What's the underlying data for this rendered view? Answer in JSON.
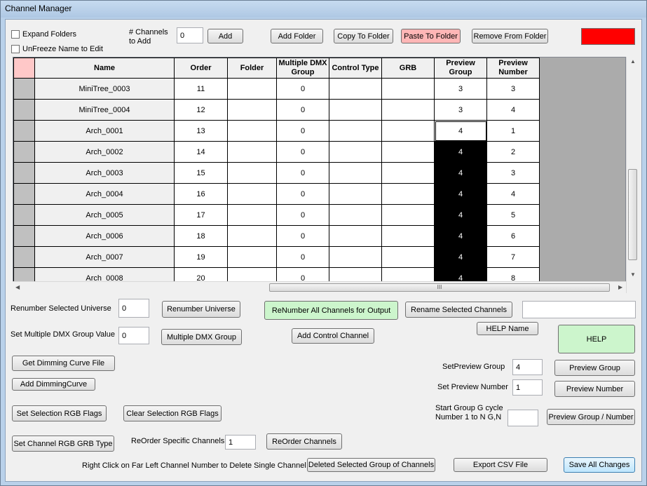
{
  "window": {
    "title": "Channel Manager"
  },
  "top": {
    "expand_folders": "Expand Folders",
    "unfreeze_name": "UnFreeze Name to Edit",
    "channels_to_add_label": "# Channels to Add",
    "channels_to_add_value": "0",
    "add": "Add",
    "add_folder": "Add Folder",
    "copy_to_folder": "Copy To Folder",
    "paste_to_folder": "Paste To Folder",
    "remove_from_folder": "Remove From Folder",
    "color_swatch": "#ff0000"
  },
  "grid": {
    "columns": [
      "Name",
      "Order",
      "Folder",
      "Multiple DMX Group",
      "Control Type",
      "GRB",
      "Preview Group",
      "Preview Number"
    ],
    "rows": [
      {
        "name": "MiniTree_0003",
        "order": "11",
        "folder": "",
        "dmx": "0",
        "control": "",
        "grb": "",
        "pgroup": "3",
        "pnumber": "3"
      },
      {
        "name": "MiniTree_0004",
        "order": "12",
        "folder": "",
        "dmx": "0",
        "control": "",
        "grb": "",
        "pgroup": "3",
        "pnumber": "4"
      },
      {
        "name": "Arch_0001",
        "order": "13",
        "folder": "",
        "dmx": "0",
        "control": "",
        "grb": "",
        "pgroup": "4",
        "pnumber": "1"
      },
      {
        "name": "Arch_0002",
        "order": "14",
        "folder": "",
        "dmx": "0",
        "control": "",
        "grb": "",
        "pgroup": "4",
        "pnumber": "2"
      },
      {
        "name": "Arch_0003",
        "order": "15",
        "folder": "",
        "dmx": "0",
        "control": "",
        "grb": "",
        "pgroup": "4",
        "pnumber": "3"
      },
      {
        "name": "Arch_0004",
        "order": "16",
        "folder": "",
        "dmx": "0",
        "control": "",
        "grb": "",
        "pgroup": "4",
        "pnumber": "4"
      },
      {
        "name": "Arch_0005",
        "order": "17",
        "folder": "",
        "dmx": "0",
        "control": "",
        "grb": "",
        "pgroup": "4",
        "pnumber": "5"
      },
      {
        "name": "Arch_0006",
        "order": "18",
        "folder": "",
        "dmx": "0",
        "control": "",
        "grb": "",
        "pgroup": "4",
        "pnumber": "6"
      },
      {
        "name": "Arch_0007",
        "order": "19",
        "folder": "",
        "dmx": "0",
        "control": "",
        "grb": "",
        "pgroup": "4",
        "pnumber": "7"
      },
      {
        "name": "Arch_0008",
        "order": "20",
        "folder": "",
        "dmx": "0",
        "control": "",
        "grb": "",
        "pgroup": "4",
        "pnumber": "8"
      }
    ],
    "selection": {
      "current_row": 2,
      "selected_rows": [
        3,
        4,
        5,
        6,
        7,
        8,
        9
      ]
    },
    "hscroll_grip": "III"
  },
  "bottom": {
    "renumber_universe_label": "Renumber Selected Universe",
    "renumber_universe_value": "0",
    "renumber_universe": "Renumber Universe",
    "renumber_all": "ReNumber All Channels for Output",
    "rename_selected": "Rename Selected Channels",
    "rename_value": "",
    "help_name": "HELP Name",
    "help": "HELP",
    "set_dmx_label": "Set Multiple DMX Group Value",
    "set_dmx_value": "0",
    "multiple_dmx_group": "Multiple DMX Group",
    "add_control_channel": "Add Control Channel",
    "get_dimming_curve": "Get Dimming Curve File",
    "add_dimming_curve": "Add DimmingCurve",
    "set_preview_group_label": "SetPreview Group",
    "set_preview_group_value": "4",
    "preview_group": "Preview Group",
    "set_preview_number_label": "Set Preview Number",
    "set_preview_number_value": "1",
    "preview_number": "Preview Number",
    "set_selection_rgb": "Set Selection RGB Flags",
    "clear_selection_rgb": "Clear Selection RGB Flags",
    "start_group_label": "Start Group G cycle Number 1 to N G,N",
    "start_group_value": "",
    "preview_group_number": "Preview Group / Number",
    "set_channel_rgb_grb": "Set Channel RGB GRB Type",
    "reorder_specific_label": "ReOrder Specific Channels",
    "reorder_specific_value": "1",
    "reorder_channels": "ReOrder Channels",
    "right_click_hint": "Right Click on Far Left Channel Number to Delete Single Channel",
    "delete_selected_group": "Deleted Selected Group of Channels",
    "export_csv": "Export CSV File",
    "save_all": "Save All Changes"
  }
}
